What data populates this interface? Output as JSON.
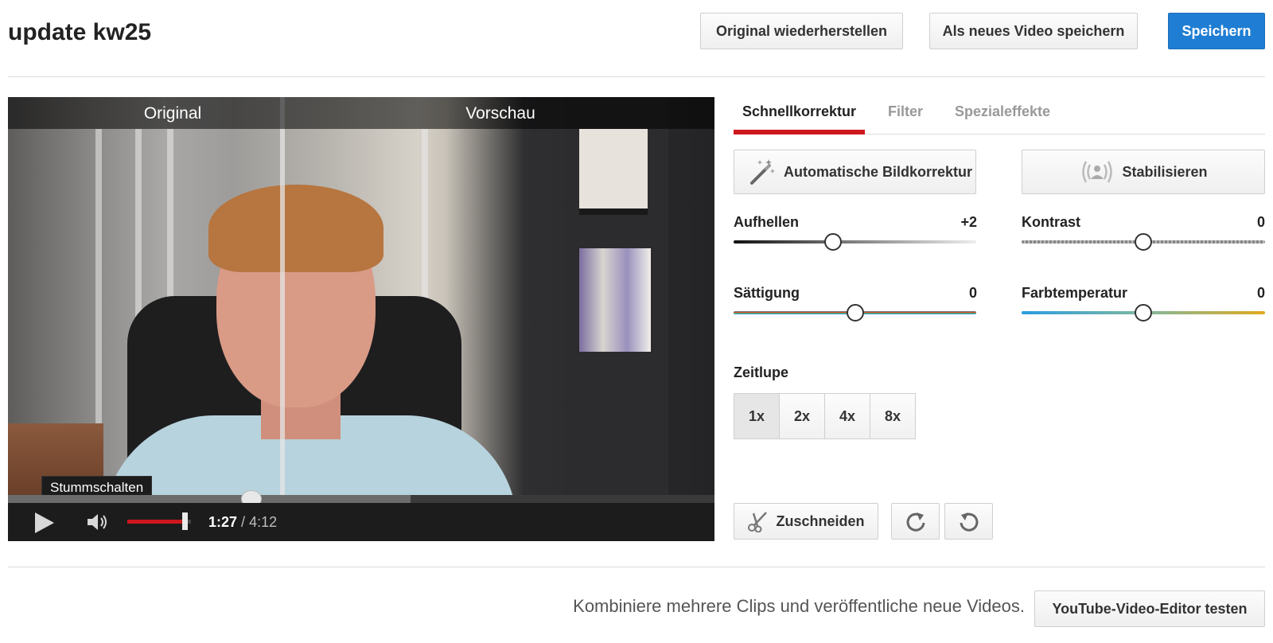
{
  "header": {
    "title": "update kw25",
    "restore_label": "Original wiederherstellen",
    "save_as_new_label": "Als neues Video speichern",
    "save_label": "Speichern"
  },
  "player": {
    "label_original": "Original",
    "label_preview": "Vorschau",
    "mute_tooltip": "Stummschalten",
    "time_current": "1:27",
    "time_separator": "/",
    "time_duration": "4:12",
    "progress_fraction": 0.345,
    "buffered_fraction": 0.57,
    "volume_fraction": 0.9
  },
  "tabs": [
    {
      "label": "Schnellkorrektur",
      "active": true
    },
    {
      "label": "Filter",
      "active": false
    },
    {
      "label": "Spezialeffekte",
      "active": false
    }
  ],
  "actions": {
    "auto_fix_label": "Automatische Bildkorrektur",
    "auto_fix_icon": "magic-wand-icon",
    "stabilize_label": "Stabilisieren",
    "stabilize_icon": "stabilize-icon"
  },
  "sliders": {
    "brightness": {
      "label": "Aufhellen",
      "value": "+2",
      "position": 0.41
    },
    "contrast": {
      "label": "Kontrast",
      "value": "0",
      "position": 0.5
    },
    "saturation": {
      "label": "Sättigung",
      "value": "0",
      "position": 0.5
    },
    "temperature": {
      "label": "Farbtemperatur",
      "value": "0",
      "position": 0.5
    }
  },
  "slowmo": {
    "label": "Zeitlupe",
    "options": [
      "1x",
      "2x",
      "4x",
      "8x"
    ],
    "selected": "1x"
  },
  "edit": {
    "trim_label": "Zuschneiden",
    "trim_icon": "scissors-icon",
    "rotate_right_icon": "rotate-right-icon",
    "rotate_left_icon": "rotate-left-icon"
  },
  "footer": {
    "text": "Kombiniere mehrere Clips und veröffentliche neue Videos.",
    "editor_button_label": "YouTube-Video-Editor testen"
  },
  "colors": {
    "primary": "#1f7ed3",
    "accent_red": "#cc181e"
  }
}
